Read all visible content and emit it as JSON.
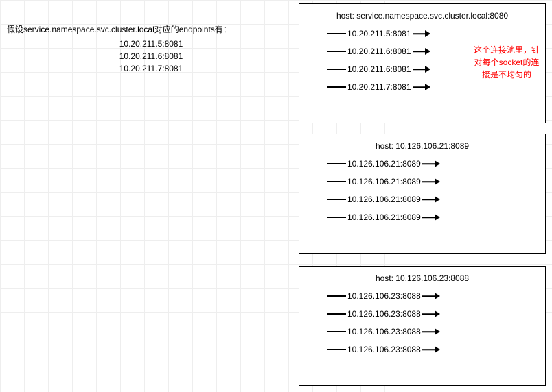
{
  "left_block": {
    "title": "假设service.namespace.svc.cluster.local对应的endpoints有：",
    "endpoints": [
      "10.20.211.5:8081",
      "10.20.211.6:8081",
      "10.20.211.7:8081"
    ]
  },
  "boxes": [
    {
      "host_label": "host:   service.namespace.svc.cluster.local:8080",
      "rows": [
        "10.20.211.5:8081",
        "10.20.211.6:8081",
        "10.20.211.6:8081",
        "10.20.211.7:8081"
      ],
      "annotation": "这个连接池里，针对每个socket的连接是不均匀的"
    },
    {
      "host_label": "host:   10.126.106.21:8089",
      "rows": [
        "10.126.106.21:8089",
        "10.126.106.21:8089",
        "10.126.106.21:8089",
        "10.126.106.21:8089"
      ]
    },
    {
      "host_label": "host:   10.126.106.23:8088",
      "rows": [
        "10.126.106.23:8088",
        "10.126.106.23:8088",
        "10.126.106.23:8088",
        "10.126.106.23:8088"
      ]
    }
  ]
}
